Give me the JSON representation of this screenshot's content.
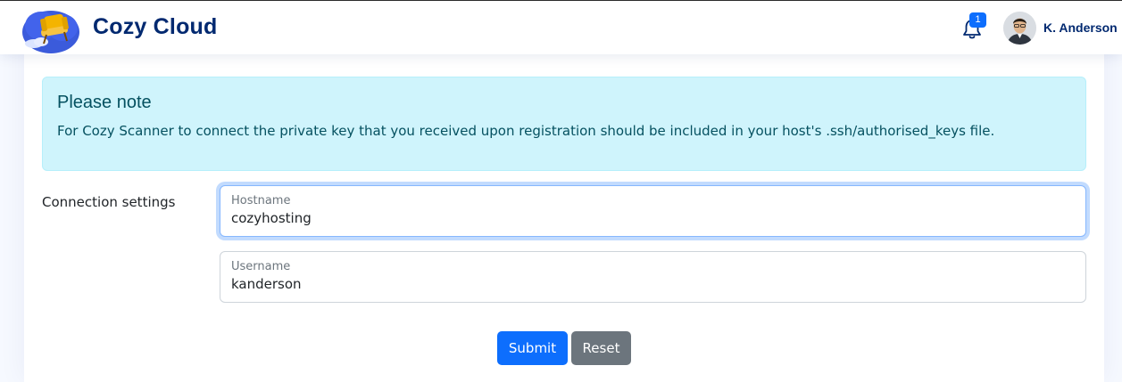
{
  "header": {
    "brand": "Cozy Cloud",
    "notifications_count": "1",
    "user_name": "K. Anderson"
  },
  "alert": {
    "heading": "Please note",
    "text": "For Cozy Scanner to connect the private key that you received upon registration should be included in your host's .ssh/authorised_keys file."
  },
  "form": {
    "section_label": "Connection settings",
    "hostname": {
      "label": "Hostname",
      "value": "cozyhosting"
    },
    "username": {
      "label": "Username",
      "value": "kanderson"
    },
    "submit_label": "Submit",
    "reset_label": "Reset"
  },
  "colors": {
    "brand": "#012970",
    "primary": "#0d6efd",
    "secondary": "#6c757d",
    "alert_bg": "#cff4fc"
  },
  "icons": [
    "cozy-logo-icon",
    "bell-icon"
  ]
}
